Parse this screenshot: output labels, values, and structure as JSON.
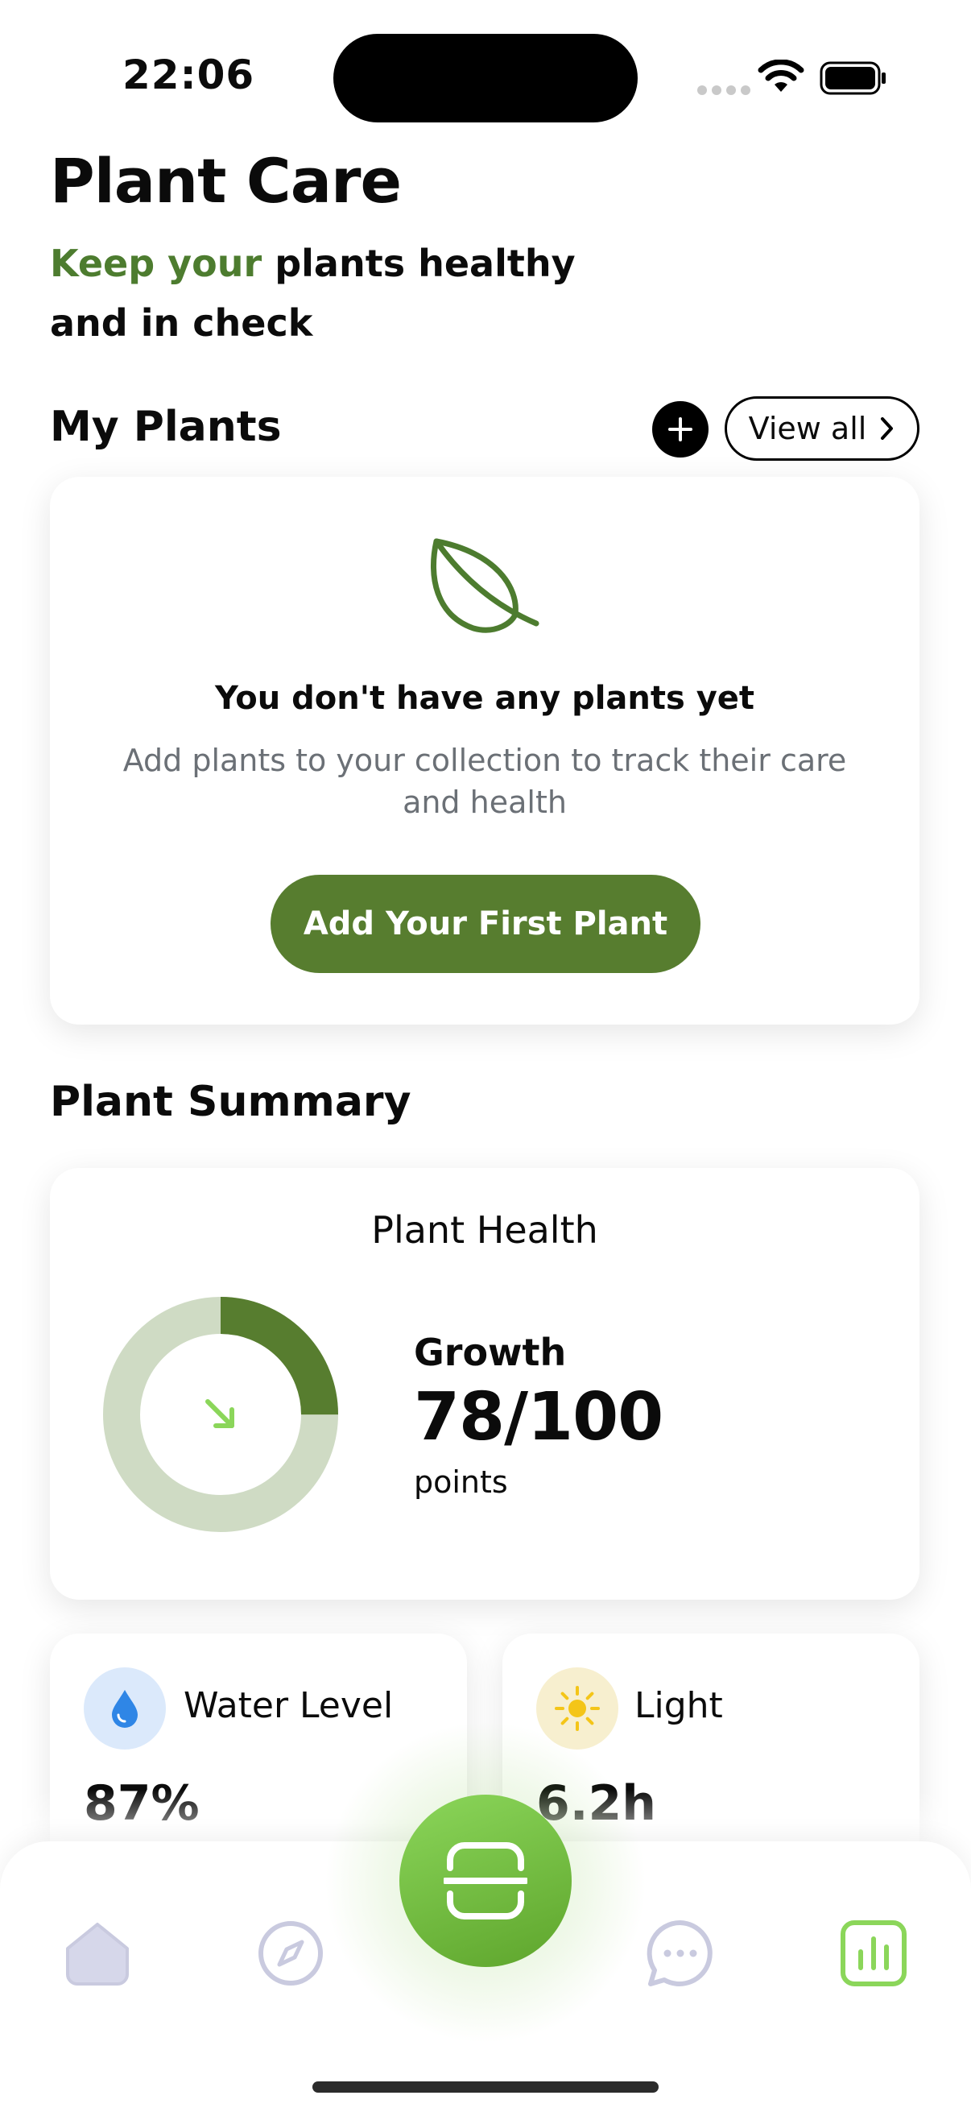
{
  "status_bar": {
    "time": "22:06"
  },
  "header": {
    "title": "Plant Care",
    "subtitle_accent": "Keep your",
    "subtitle_rest": " plants healthy",
    "subtitle_line2": "and in check"
  },
  "my_plants": {
    "title": "My Plants",
    "view_all_label": "View all",
    "empty_title": "You don't have any plants yet",
    "empty_description": "Add plants to your collection to track their care and health",
    "add_first_label": "Add Your First Plant"
  },
  "summary": {
    "title": "Plant Summary",
    "health": {
      "title": "Plant Health",
      "metric_label": "Growth",
      "value": "78/100",
      "unit": "points",
      "donut_fill_fraction": 0.25
    },
    "stats": [
      {
        "label": "Water Level",
        "value": "87%",
        "icon": "water-drop-icon"
      },
      {
        "label": "Light",
        "value": "6.2h",
        "icon": "sun-icon"
      }
    ]
  },
  "tabbar": {
    "items": [
      "home-icon",
      "compass-icon",
      "scan-icon",
      "chat-icon",
      "stats-icon"
    ],
    "active": "stats-icon"
  },
  "colors": {
    "brand_green": "#577d2f",
    "accent_green": "#4d7c2f",
    "donut_track": "#cfdbc4",
    "scan_green": "#7cc44b",
    "tab_inactive": "#c9cadf",
    "tab_active": "#8bd65a"
  }
}
